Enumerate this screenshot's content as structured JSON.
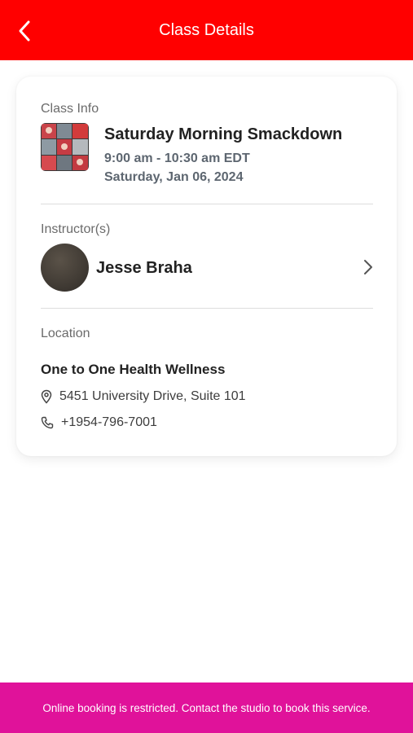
{
  "header": {
    "title": "Class Details",
    "back_icon": "chevron-left-icon",
    "background_color": "#ff0000"
  },
  "class_info": {
    "section_label": "Class Info",
    "title": "Saturday Morning Smackdown",
    "time": "9:00 am - 10:30 am EDT",
    "date": "Saturday, Jan 06, 2024"
  },
  "instructors": {
    "section_label": "Instructor(s)",
    "items": [
      {
        "name": "Jesse Braha",
        "chevron_icon": "chevron-right-icon"
      }
    ]
  },
  "location": {
    "section_label": "Location",
    "name": "One to One Health Wellness",
    "address": "5451 University Drive, Suite 101",
    "address_icon": "map-pin-icon",
    "phone": "+1954-796-7001",
    "phone_icon": "phone-icon"
  },
  "footer": {
    "message": "Online booking is restricted. Contact the studio to book this service.",
    "background_color": "#e0129a"
  }
}
